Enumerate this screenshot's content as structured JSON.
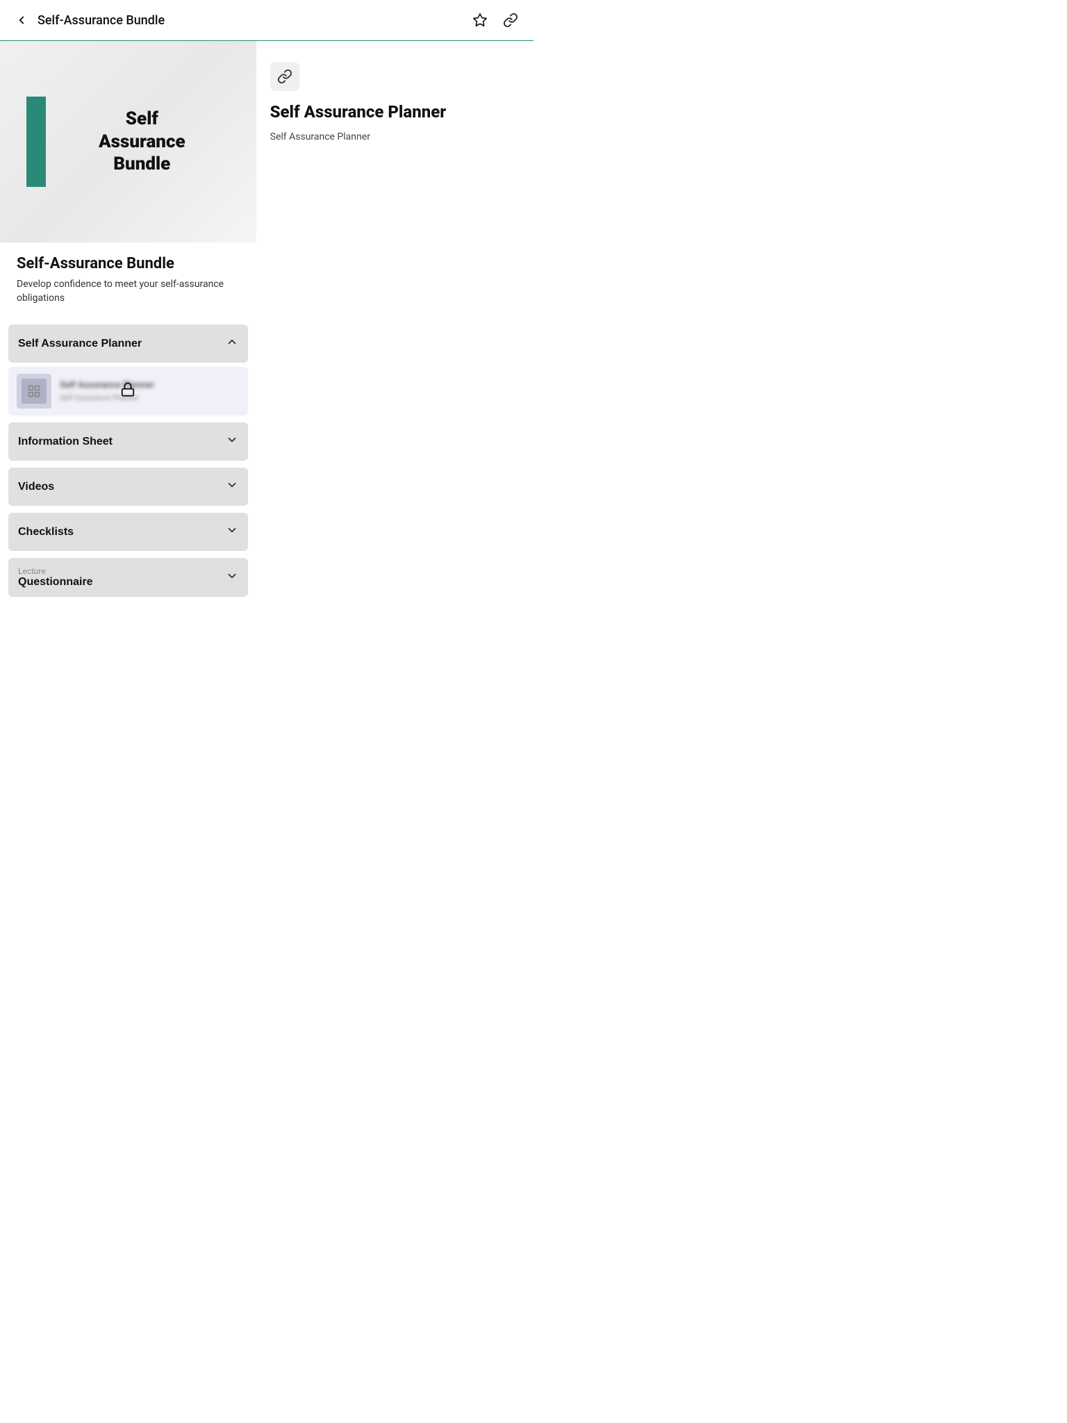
{
  "header": {
    "title": "Self-Assurance Bundle",
    "back_label": "Back"
  },
  "hero": {
    "teal_color": "#2a8a7a",
    "text_line1": "Self",
    "text_line2": "Assurance",
    "text_line3": "Bundle"
  },
  "bundle": {
    "title": "Self-Assurance Bundle",
    "description": "Develop confidence to meet your self-assurance obligations"
  },
  "accordion": {
    "section1_label": "Self Assurance Planner",
    "locked_item_line1": "Self Assurance Planner",
    "locked_item_line2": "Self Assurance Planner",
    "section2_label": "Information Sheet",
    "section3_label": "Videos",
    "section4_label": "Checklists",
    "lecture_sub": "Lecture",
    "lecture_title": "Questionnaire"
  },
  "right_panel": {
    "link_icon": "🔗",
    "title": "Self Assurance Planner",
    "subtitle": "Self Assurance Planner"
  },
  "icons": {
    "back_arrow": "‹",
    "star": "☆",
    "share": "🔗",
    "chevron_up": "∧",
    "chevron_down": "∨",
    "lock": "🔒",
    "link": "🔗",
    "grid": "⊞"
  }
}
